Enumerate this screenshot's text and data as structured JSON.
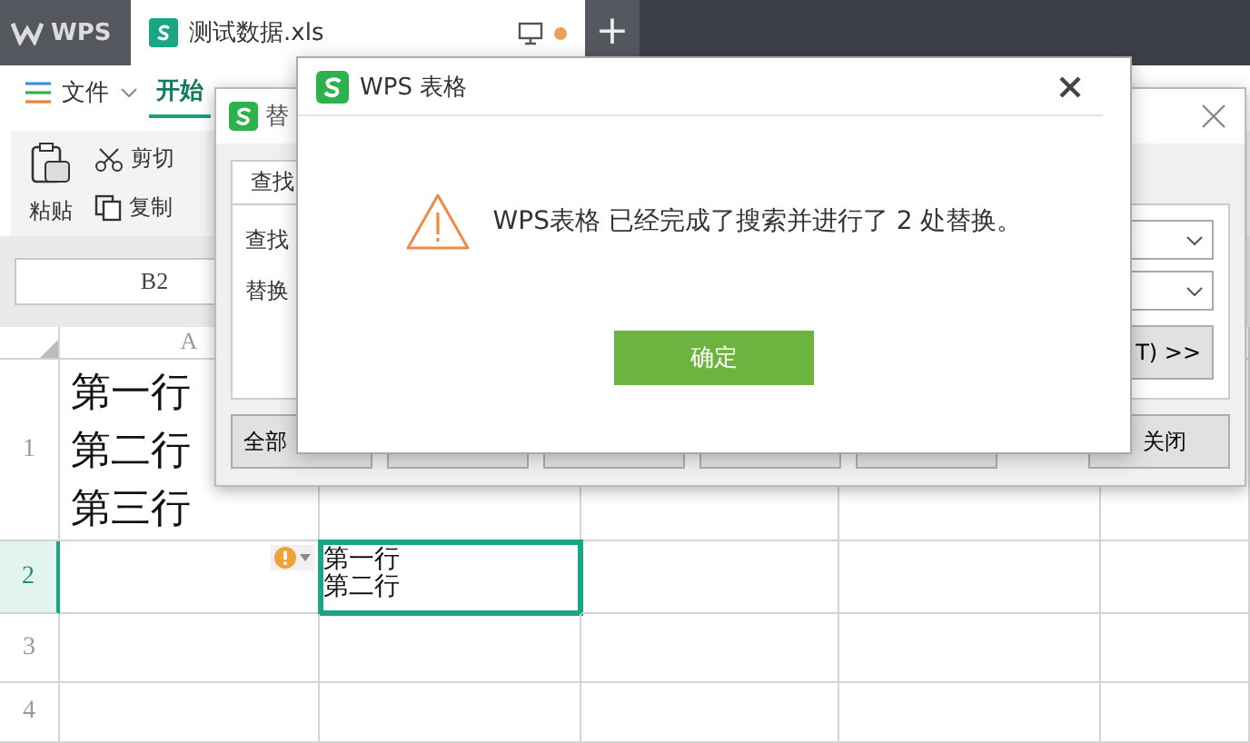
{
  "app_bar": {
    "logo": "WPS",
    "tabs": [
      {
        "label": "测试数据.xls",
        "selected": true,
        "modified": true
      }
    ],
    "new_tab": "+"
  },
  "menu": [
    {
      "label": "文件",
      "kind": "dropdown",
      "selected": false
    },
    {
      "label": "开始",
      "kind": "tab",
      "selected": true
    }
  ],
  "toolbar": [
    {
      "label": "粘贴",
      "kind": "large"
    },
    {
      "label": "剪切",
      "kind": "cut"
    },
    {
      "label": "复制",
      "kind": "copy"
    }
  ],
  "name_box": "B2",
  "sheet": {
    "columns": [
      "A"
    ],
    "rows": [
      {
        "header": "1",
        "selected": false,
        "cells": [
          {
            "kind": "large",
            "lines": [
              "第一行",
              "第二行",
              "第三行"
            ]
          }
        ]
      },
      {
        "header": "2",
        "selected": true,
        "warning": true,
        "cells": [
          {
            "selected": false
          },
          {
            "kind": "plain",
            "lines": [
              "第一行",
              "第二行"
            ],
            "selected": true
          }
        ]
      },
      {
        "header": "3",
        "selected": false,
        "cells": []
      },
      {
        "header": "4",
        "selected": false,
        "cells": []
      }
    ]
  },
  "replace_dialog": {
    "title": "替",
    "tab": "查找",
    "fields": [
      {
        "label": "查找"
      },
      {
        "label": "替换"
      }
    ],
    "more_button": "T) >>",
    "buttons": [
      {
        "kind": "text",
        "label": "全部"
      },
      {
        "kind": "covered"
      },
      {
        "kind": "covered"
      },
      {
        "kind": "covered"
      },
      {
        "kind": "covered"
      },
      {
        "kind": "text",
        "label": "关闭"
      }
    ]
  },
  "message_dialog": {
    "title": "WPS 表格",
    "message": "WPS表格 已经完成了搜索并进行了 2 处替换。",
    "ok_button": "确定"
  }
}
